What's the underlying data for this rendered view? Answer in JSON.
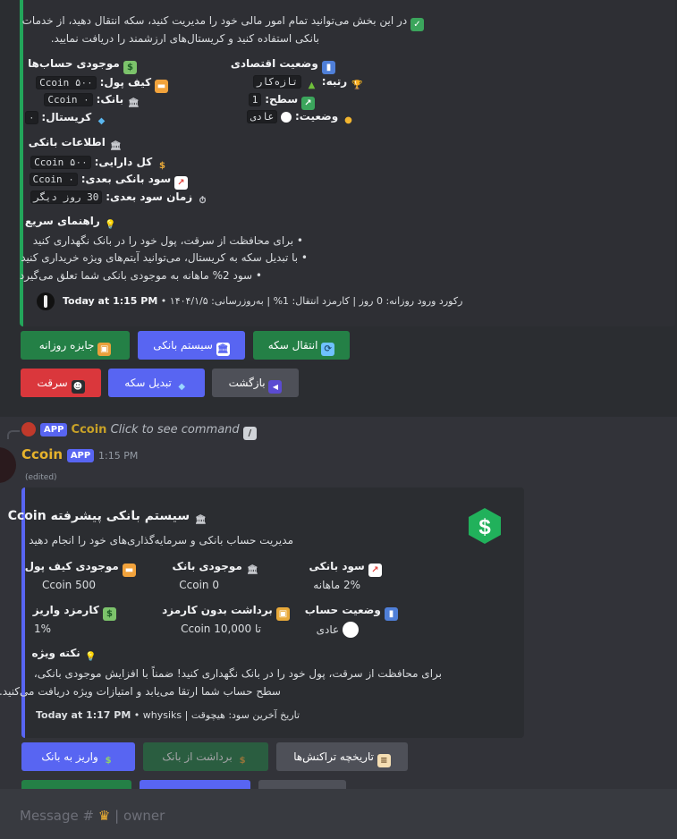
{
  "msg1": {
    "intro_line1": "در این بخش می‌توانید تمام امور مالی خود را مدیریت کنید، سکه انتقال دهید، از خدمات",
    "intro_line2": "بانکی استفاده کنید و کریستال‌های ارزشمند را دریافت نمایید.",
    "economy_title": "وضعیت اقتصادی",
    "rank_label": "رتبه:",
    "rank_value": "تازه‌کار",
    "level_label": "سطح:",
    "level_value": "1",
    "status_label": "وضعیت:",
    "status_value": "عادی",
    "balance_title": "موجودی حساب‌ها",
    "wallet_label": "کیف پول:",
    "wallet_value": "Ccoin ۵۰۰",
    "bank_label": "بانک:",
    "bank_value": "Ccoin ۰",
    "crystal_label": "کریستال:",
    "crystal_value": "۰",
    "bankinfo_title": "اطلاعات بانکی",
    "assets_label": "کل دارایی:",
    "assets_value": "Ccoin ۵۰۰",
    "next_interest_label": "سود بانکی بعدی:",
    "next_interest_value": "Ccoin ۰",
    "next_time_label": "زمان سود بعدی:",
    "next_time_value": "30 روز دیگر",
    "guide_title": "راهنمای سریع",
    "guide_1": "• برای محافظت از سرقت، پول خود را در بانک نگهداری کنید",
    "guide_2": "• با تبدیل سکه به کریستال، می‌توانید آیتم‌های ویژه خریداری کنید",
    "guide_3": "• سود 2% ماهانه به موجودی بانکی شما تعلق می‌گیرد",
    "footer_text": "رکورد ورود روزانه: 0 روز | کارمزد انتقال: 1% | بەروزرسانی: ۱۴۰۴/۱/۵",
    "footer_time": "Today at 1:15 PM",
    "buttons_row1": [
      "انتقال سکه",
      "سیستم بانکی",
      "جایزه روزانه"
    ],
    "buttons_row2": [
      "بازگشت",
      "تبدیل سکه",
      "سرقت"
    ]
  },
  "reply": {
    "badge": "APP",
    "name": "Ccoin",
    "text": "Click to see command"
  },
  "msg2": {
    "author": "Ccoin",
    "badge": "APP",
    "time": "1:15 PM",
    "edited": "(edited)",
    "title": "سیستم بانکی پیشرفته Ccoin",
    "description": "مدیریت حساب بانکی و سرمایه‌گذاری‌های خود را انجام دهید",
    "fields": [
      {
        "name": "سود بانکی",
        "value": "2% ماهانه"
      },
      {
        "name": "موجودی بانک",
        "value": "0 Ccoin"
      },
      {
        "name": "موجودی کیف پول",
        "value": "500 Ccoin"
      },
      {
        "name": "وضعیت حساب",
        "value": "عادی"
      },
      {
        "name": "برداشت بدون کارمزد",
        "value": "تا Ccoin 10,000"
      },
      {
        "name": "کارمزد واریز",
        "value": "1%"
      }
    ],
    "tip_title": "نکته ویژه",
    "tip_line1": "برای محافظت از سرقت، پول خود را در بانک نگهداری کنید! ضمناً با افزایش موجودی بانکی،",
    "tip_line2": "سطح حساب شما ارتقا می‌یابد و امتیازات ویژه دریافت می‌کنید.",
    "footer_text": "whysiks | تاریخ آخرین سود: هیچوقت",
    "footer_time": "Today at 1:17 PM",
    "buttons": [
      "واریز به بانک",
      "برداشت از بانک",
      "تاریخچه تراکنش‌ها"
    ]
  },
  "composer": {
    "placeholder_prefix": "Message #",
    "channel": "owner"
  },
  "colors": {
    "green_bar": "#23a55a",
    "blurple": "#5865f2",
    "red": "#da373c",
    "gray": "#4e5058"
  }
}
